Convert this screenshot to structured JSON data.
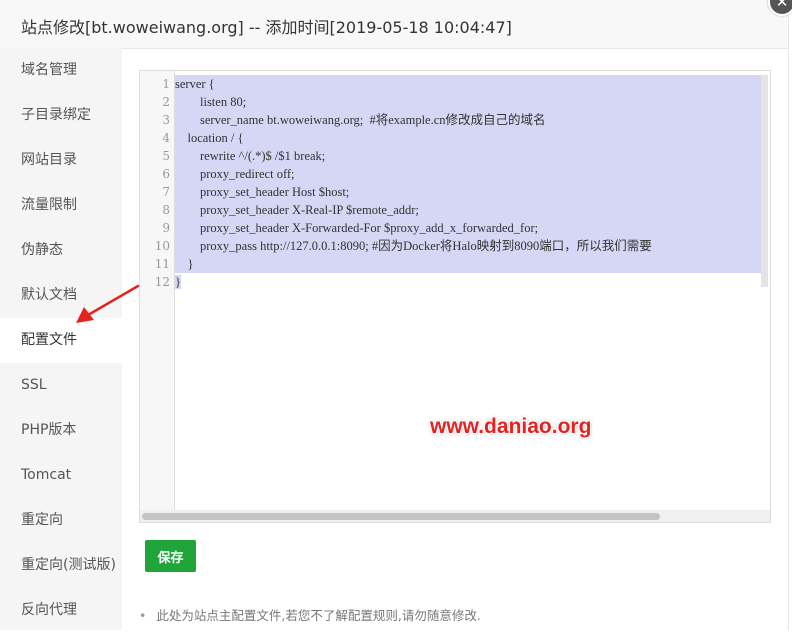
{
  "dialog": {
    "title": "站点修改[bt.woweiwang.org] -- 添加时间[2019-05-18 10:04:47]",
    "close_label": "✕"
  },
  "sidebar": {
    "items": [
      {
        "label": "域名管理"
      },
      {
        "label": "子目录绑定"
      },
      {
        "label": "网站目录"
      },
      {
        "label": "流量限制"
      },
      {
        "label": "伪静态"
      },
      {
        "label": "默认文档"
      },
      {
        "label": "配置文件",
        "active": true
      },
      {
        "label": "SSL"
      },
      {
        "label": "PHP版本"
      },
      {
        "label": "Tomcat"
      },
      {
        "label": "重定向"
      },
      {
        "label": "重定向(测试版)"
      },
      {
        "label": "反向代理"
      }
    ]
  },
  "editor": {
    "line_numbers": [
      "1",
      "2",
      "3",
      "4",
      "5",
      "6",
      "7",
      "8",
      "9",
      "10",
      "11",
      "12"
    ],
    "lines": [
      "server {",
      "        listen 80;",
      "        server_name bt.woweiwang.org;  #将example.cn修改成自己的域名",
      "    location / {",
      "        rewrite ^/(.*)$ /$1 break;",
      "        proxy_redirect off;",
      "        proxy_set_header Host $host;",
      "        proxy_set_header X-Real-IP $remote_addr;",
      "        proxy_set_header X-Forwarded-For $proxy_add_x_forwarded_for;",
      "        proxy_pass http://127.0.0.1:8090; #因为Docker将Halo映射到8090端口，所以我们需要",
      "    }",
      "}"
    ],
    "selection_color": "#d6d6f5"
  },
  "watermark": "www.daniao.org",
  "save_label": "保存",
  "tip": {
    "bullet": "•",
    "text": "此处为站点主配置文件,若您不了解配置规则,请勿随意修改."
  },
  "colors": {
    "accent_green": "#20a53a",
    "arrow_red": "#e4231f",
    "sidebar_bg": "#f5f5f5"
  }
}
